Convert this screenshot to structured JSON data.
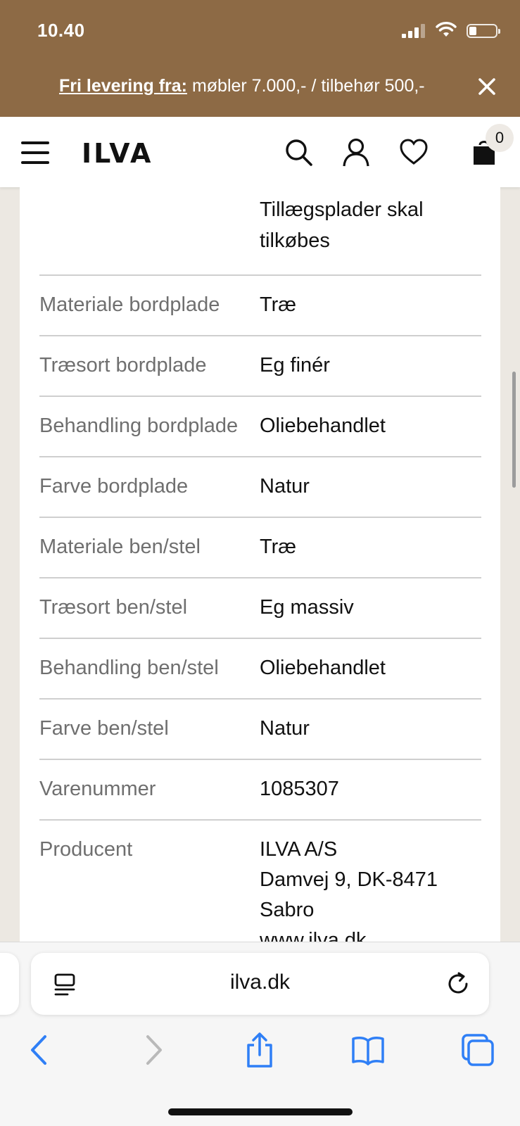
{
  "status_bar": {
    "time": "10.40"
  },
  "promo": {
    "strong": "Fri levering fra:",
    "text": " møbler 7.000,- / tilbehør 500,-"
  },
  "header": {
    "logo": "ILVA",
    "cart_count": "0"
  },
  "specs": {
    "top_value": "Tillægsplader skal tilkøbes",
    "rows": [
      {
        "label": "Materiale bordplade",
        "value": "Træ"
      },
      {
        "label": "Træsort bordplade",
        "value": "Eg finér"
      },
      {
        "label": "Behandling bordplade",
        "value": "Oliebehandlet"
      },
      {
        "label": "Farve bordplade",
        "value": "Natur"
      },
      {
        "label": "Materiale ben/stel",
        "value": "Træ"
      },
      {
        "label": "Træsort ben/stel",
        "value": "Eg massiv"
      },
      {
        "label": "Behandling ben/stel",
        "value": "Oliebehandlet"
      },
      {
        "label": "Farve ben/stel",
        "value": "Natur"
      },
      {
        "label": "Varenummer",
        "value": "1085307"
      },
      {
        "label": "Producent",
        "value": "ILVA A/S",
        "lines": [
          "Damvej 9, DK-8471",
          "Sabro",
          "www.ilva.dk"
        ]
      }
    ]
  },
  "browser": {
    "url": "ilva.dk"
  },
  "colors": {
    "banner": "#8d6a45",
    "ios_blue": "#2f7ff6"
  }
}
